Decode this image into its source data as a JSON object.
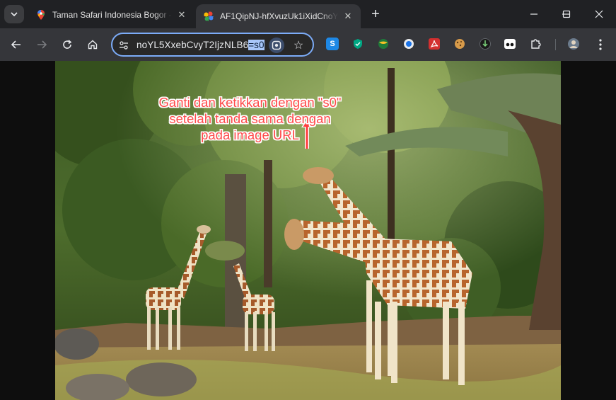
{
  "tabs": [
    {
      "title": "Taman Safari Indonesia Bogor -",
      "favicon": "google-maps-icon",
      "active": false
    },
    {
      "title": "AF1QipNJ-hfXvuzUk1iXidCnoYL",
      "favicon": "google-photos-icon",
      "active": true
    }
  ],
  "toolbar": {
    "url_text": "noYL5XxebCvyT2IjzNLB6",
    "url_selected": "=s0"
  },
  "extensions": [
    "s-extension-icon",
    "shield-extension-icon",
    "globe-extension-icon",
    "circle-extension-icon",
    "pdf-extension-icon",
    "cookie-extension-icon",
    "download-extension-icon",
    "eye-extension-icon",
    "puzzle-extension-icon",
    "profile-avatar-icon"
  ],
  "annotation": {
    "line1": "Ganti dan ketikkan dengan \"s0\"",
    "line2": "setelah tanda sama dengan",
    "line3": "pada image URL"
  },
  "colors": {
    "annotation_red": "#ff4a4a",
    "omnibox_focus": "#7cacf8",
    "selection": "#a8c7fa"
  }
}
